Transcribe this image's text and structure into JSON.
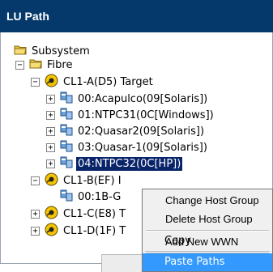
{
  "panel": {
    "title": "LU Path"
  },
  "tree": {
    "root": {
      "label": "Subsystem",
      "icon": "folder-icon"
    },
    "fibre": {
      "label": "Fibre",
      "icon": "folder-icon"
    },
    "port_a": {
      "label": "CL1-A(D5) Target",
      "icon": "port-icon",
      "children": [
        "00:Acapulco(09[Solaris])",
        "01:NTPC31(0C[Windows])",
        "02:Quasar2(09[Solaris])",
        "03:Quasar-1(09[Solaris])",
        "04:NTPC32(0C[HP])"
      ]
    },
    "port_b": {
      "label": "CL1-B(EF) I",
      "child": "00:1B-G"
    },
    "port_c": {
      "label": "CL1-C(E8) T"
    },
    "port_d": {
      "label": "CL1-D(1F) T"
    }
  },
  "context_menu": {
    "items": [
      "Change Host Group",
      "Delete Host Group",
      "Add New WWN",
      "Copy",
      "Paste Paths"
    ],
    "highlighted": "Paste Paths"
  },
  "colors": {
    "titlebar": "#06396b",
    "selection": "#0a246a",
    "menu_highlight": "#3399ff",
    "port_yellow": "#f5c400"
  }
}
